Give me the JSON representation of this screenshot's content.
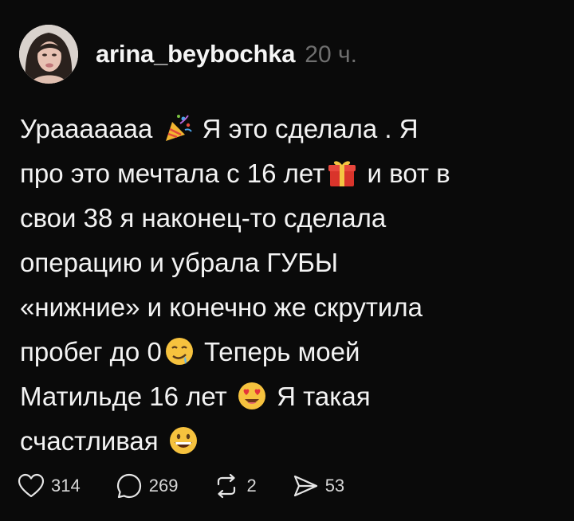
{
  "post": {
    "author": {
      "username": "arina_beybochka",
      "time": "20 ч."
    },
    "text_lines": [
      {
        "before": "Урааааааа",
        "emoji": "party-popper-icon",
        "after": "Я это сделала . Я"
      },
      {
        "before": "про это мечтала с 16 лет",
        "emoji": "gift-icon",
        "after": "и вот в"
      },
      {
        "before": "свои 38 я наконец-то сделала",
        "emoji": "",
        "after": ""
      },
      {
        "before": "операцию и убрала ГУБЫ",
        "emoji": "",
        "after": ""
      },
      {
        "before": "«нижние» и конечно же скрутила",
        "emoji": "",
        "after": ""
      },
      {
        "before": "пробег до 0",
        "emoji": "drooling-face-icon",
        "after": "Теперь моей"
      },
      {
        "before": "Матильде 16 лет",
        "emoji": "heart-eyes-icon",
        "after": "Я такая"
      },
      {
        "before": "счастливая",
        "emoji": "grinning-face-icon",
        "after": ""
      }
    ],
    "actions": {
      "likes": "314",
      "comments": "269",
      "reposts": "2",
      "shares": "53"
    }
  }
}
